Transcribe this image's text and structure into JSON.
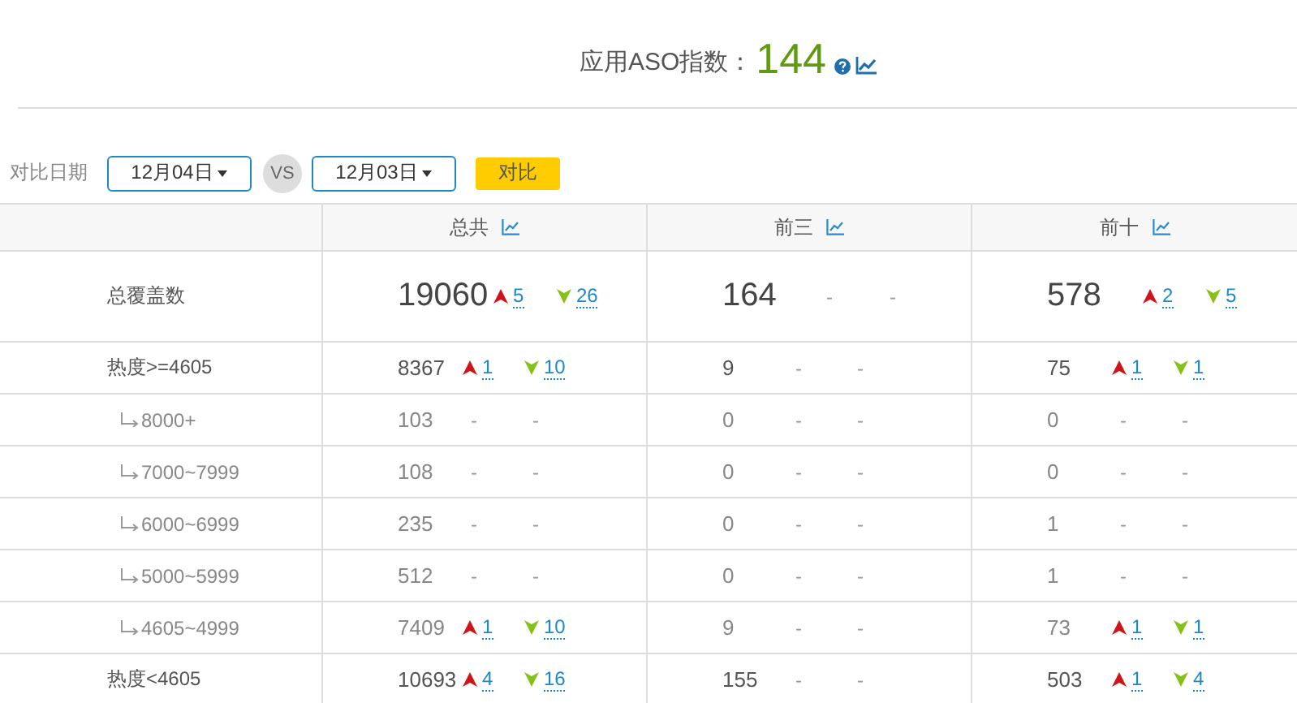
{
  "header": {
    "title": "应用ASO指数：",
    "score": "144"
  },
  "compare": {
    "label": "对比日期",
    "date_a": "12月04日",
    "vs": "VS",
    "date_b": "12月03日",
    "button": "对比"
  },
  "table": {
    "columns": [
      "总共",
      "前三",
      "前十"
    ],
    "rows": [
      {
        "label": "总覆盖数",
        "kind": "total",
        "cells": [
          {
            "value": "19060",
            "up": {
              "text": "5",
              "arrow": true
            },
            "down": {
              "text": "26",
              "arrow": true
            }
          },
          {
            "value": "164",
            "up": {
              "text": "-",
              "arrow": false
            },
            "down": {
              "text": "-",
              "arrow": false
            }
          },
          {
            "value": "578",
            "up": {
              "text": "2",
              "arrow": true
            },
            "down": {
              "text": "5",
              "arrow": true
            }
          }
        ]
      },
      {
        "label": "热度>=4605",
        "kind": "group",
        "cells": [
          {
            "value": "8367",
            "up": {
              "text": "1",
              "arrow": true
            },
            "down": {
              "text": "10",
              "arrow": true
            }
          },
          {
            "value": "9",
            "up": {
              "text": "-",
              "arrow": false
            },
            "down": {
              "text": "-",
              "arrow": false
            }
          },
          {
            "value": "75",
            "up": {
              "text": "1",
              "arrow": true
            },
            "down": {
              "text": "1",
              "arrow": true
            }
          }
        ],
        "children": [
          {
            "label": "8000+",
            "cells": [
              {
                "value": "103",
                "up": {
                  "text": "-",
                  "arrow": false
                },
                "down": {
                  "text": "-",
                  "arrow": false
                }
              },
              {
                "value": "0",
                "up": {
                  "text": "-",
                  "arrow": false
                },
                "down": {
                  "text": "-",
                  "arrow": false
                }
              },
              {
                "value": "0",
                "up": {
                  "text": "-",
                  "arrow": false
                },
                "down": {
                  "text": "-",
                  "arrow": false
                }
              }
            ]
          },
          {
            "label": "7000~7999",
            "cells": [
              {
                "value": "108",
                "up": {
                  "text": "-",
                  "arrow": false
                },
                "down": {
                  "text": "-",
                  "arrow": false
                }
              },
              {
                "value": "0",
                "up": {
                  "text": "-",
                  "arrow": false
                },
                "down": {
                  "text": "-",
                  "arrow": false
                }
              },
              {
                "value": "0",
                "up": {
                  "text": "-",
                  "arrow": false
                },
                "down": {
                  "text": "-",
                  "arrow": false
                }
              }
            ]
          },
          {
            "label": "6000~6999",
            "cells": [
              {
                "value": "235",
                "up": {
                  "text": "-",
                  "arrow": false
                },
                "down": {
                  "text": "-",
                  "arrow": false
                }
              },
              {
                "value": "0",
                "up": {
                  "text": "-",
                  "arrow": false
                },
                "down": {
                  "text": "-",
                  "arrow": false
                }
              },
              {
                "value": "1",
                "up": {
                  "text": "-",
                  "arrow": false
                },
                "down": {
                  "text": "-",
                  "arrow": false
                }
              }
            ]
          },
          {
            "label": "5000~5999",
            "cells": [
              {
                "value": "512",
                "up": {
                  "text": "-",
                  "arrow": false
                },
                "down": {
                  "text": "-",
                  "arrow": false
                }
              },
              {
                "value": "0",
                "up": {
                  "text": "-",
                  "arrow": false
                },
                "down": {
                  "text": "-",
                  "arrow": false
                }
              },
              {
                "value": "1",
                "up": {
                  "text": "-",
                  "arrow": false
                },
                "down": {
                  "text": "-",
                  "arrow": false
                }
              }
            ]
          },
          {
            "label": "4605~4999",
            "cells": [
              {
                "value": "7409",
                "up": {
                  "text": "1",
                  "arrow": true
                },
                "down": {
                  "text": "10",
                  "arrow": true
                }
              },
              {
                "value": "9",
                "up": {
                  "text": "-",
                  "arrow": false
                },
                "down": {
                  "text": "-",
                  "arrow": false
                }
              },
              {
                "value": "73",
                "up": {
                  "text": "1",
                  "arrow": true
                },
                "down": {
                  "text": "1",
                  "arrow": true
                }
              }
            ]
          }
        ]
      },
      {
        "label": "热度<4605",
        "kind": "group",
        "cells": [
          {
            "value": "10693",
            "up": {
              "text": "4",
              "arrow": true
            },
            "down": {
              "text": "16",
              "arrow": true
            }
          },
          {
            "value": "155",
            "up": {
              "text": "-",
              "arrow": false
            },
            "down": {
              "text": "-",
              "arrow": false
            }
          },
          {
            "value": "503",
            "up": {
              "text": "1",
              "arrow": true
            },
            "down": {
              "text": "4",
              "arrow": true
            }
          }
        ]
      }
    ]
  }
}
